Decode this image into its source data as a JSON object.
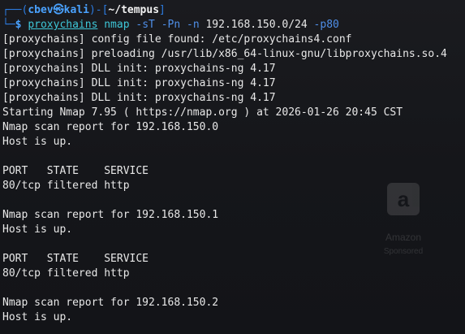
{
  "prompt": {
    "frame_top": "┌──(",
    "user_host": "cbev㉿kali",
    "frame_mid": ")-[",
    "cwd": "~/tempus",
    "frame_end": "]",
    "frame_bottom": "└─",
    "dollar": "$",
    "program": "proxychains",
    "command": "nmap",
    "opt1": "-sT",
    "opt2": "-Pn",
    "opt3": "-n",
    "target": "192.168.150.0/24",
    "opt4": "-p80"
  },
  "output": [
    "[proxychains] config file found: /etc/proxychains4.conf",
    "[proxychains] preloading /usr/lib/x86_64-linux-gnu/libproxychains.so.4",
    "[proxychains] DLL init: proxychains-ng 4.17",
    "[proxychains] DLL init: proxychains-ng 4.17",
    "[proxychains] DLL init: proxychains-ng 4.17",
    "Starting Nmap 7.95 ( https://nmap.org ) at 2026-01-26 20:45 CST",
    "Nmap scan report for 192.168.150.0",
    "Host is up.",
    "",
    "PORT   STATE    SERVICE",
    "80/tcp filtered http",
    "",
    "Nmap scan report for 192.168.150.1",
    "Host is up.",
    "",
    "PORT   STATE    SERVICE",
    "80/tcp filtered http",
    "",
    "Nmap scan report for 192.168.150.2",
    "Host is up."
  ],
  "watermark": {
    "logo": "a",
    "name": "Amazon",
    "sub": "Sponsored"
  }
}
